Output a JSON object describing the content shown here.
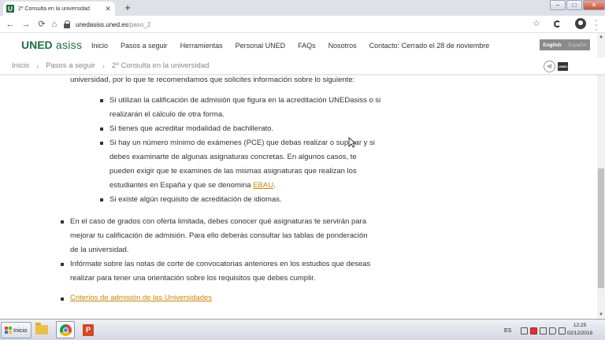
{
  "browser": {
    "tab_title": "2º Consulta en la universidad",
    "tab_favicon": "U",
    "url_host": "unedasiss.uned.es",
    "url_path": "/paso_2",
    "window_controls": [
      "–",
      "□",
      "✕"
    ]
  },
  "site": {
    "logo_uned": "UNED",
    "logo_asiss": " asiss",
    "nav": [
      "Inicio",
      "Pasos a seguir",
      "Herramientas",
      "Personal UNED",
      "FAQs",
      "Nosotros",
      "Contacto: Cerrado el 28 de noviembre"
    ],
    "lang_english": "English",
    "lang_spanish": "Español",
    "mini_logo": "UNED"
  },
  "breadcrumb": [
    "Inicio",
    "Pasos a seguir",
    "2º Consulta en la universidad"
  ],
  "content": {
    "intro_partial": "universidad, por lo que te recomendamos que solicites información sobre lo siguiente:",
    "sub_items": [
      {
        "lines": [
          "Si utilizan la calificación de admisión que figura en la acreditación UNEDasiss o si",
          "realizarán el cálculo de otra forma."
        ]
      },
      {
        "lines": [
          "Si tienes que acreditar modalidad de bachillerato."
        ]
      },
      {
        "lines": [
          "Si hay un número mínimo de exámenes (PCE) que debas realizar o superar y si",
          "debes examinarte de algunas asignaturas concretas. En algunos casos, te",
          "pueden exigir que te examines de las mismas asignaturas que realizan los"
        ],
        "last_prefix": "estudiantes en España y que se denomina ",
        "last_link": "EBAU",
        "last_suffix": "."
      },
      {
        "lines": [
          "Si existe algún requisito de acreditación de idiomas."
        ]
      }
    ],
    "top_items": [
      {
        "lines": [
          "En el caso de grados con oferta limitada, debes conocer qué asignaturas te servirán para",
          "mejorar tu calificación de admisión. Para ello deberás consultar las tablas de ponderación",
          "de la universidad."
        ]
      },
      {
        "lines": [
          "Infórmate sobre las notas de corte de convocatorias anteriores en los estudios que deseas",
          "realizar para tener una orientación sobre los requisitos que debes cumplir."
        ]
      }
    ],
    "link_criteria": "Criterios de admisión de las Universidades"
  },
  "taskbar": {
    "start_label": "Inicio",
    "lang": "ES",
    "time": "12:25",
    "date": "02/12/2019"
  },
  "colors": {
    "brand_green": "#1d6f42",
    "link_orange": "#c8860a"
  }
}
